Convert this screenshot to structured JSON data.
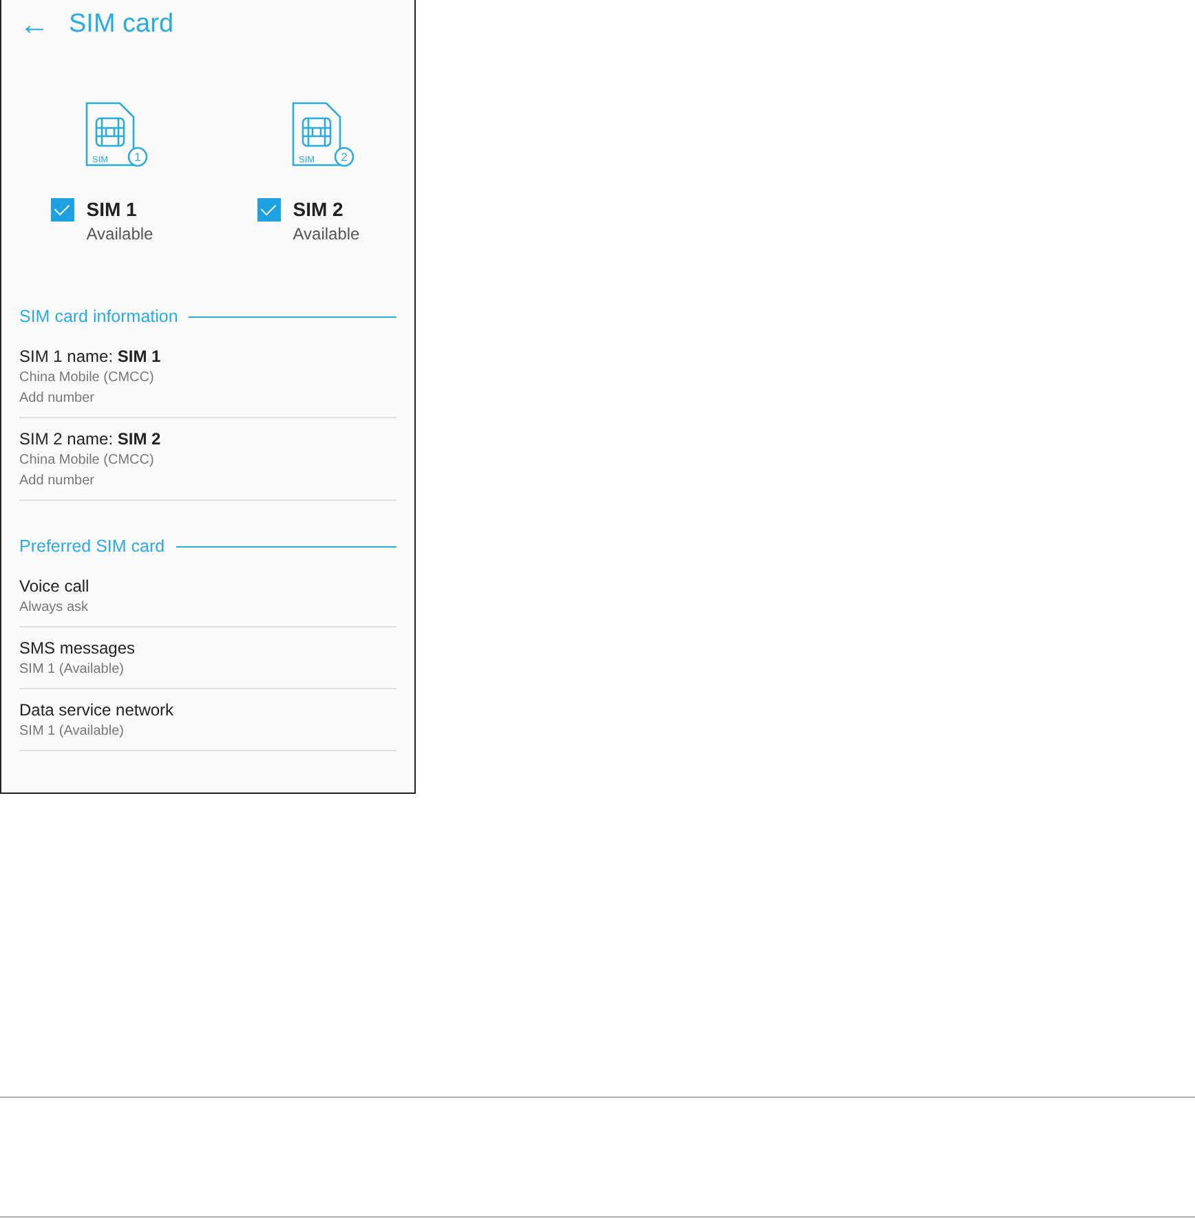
{
  "app_bar": {
    "back": "←",
    "title": "SIM card"
  },
  "sims": [
    {
      "badge": "SIM",
      "number": "1",
      "name": "SIM 1",
      "status": "Available",
      "checked": true
    },
    {
      "badge": "SIM",
      "number": "2",
      "name": "SIM 2",
      "status": "Available",
      "checked": true
    }
  ],
  "sections": [
    {
      "title": "SIM card information",
      "items": [
        {
          "title": "SIM 1 name: **SIM 1**",
          "lines": [
            "China Mobile (CMCC)",
            "Add number"
          ]
        },
        {
          "title": "SIM 2 name: **SIM 2**",
          "lines": [
            "China Mobile (CMCC)",
            "Add number"
          ]
        }
      ]
    },
    {
      "title": "Preferred SIM card",
      "items": [
        {
          "title": "Voice call",
          "lines": [
            "Always ask"
          ]
        },
        {
          "title": "SMS messages",
          "lines": [
            "SIM 1 (Available)"
          ]
        },
        {
          "title": "Data service network",
          "lines": [
            "SIM 1 (Available)"
          ]
        }
      ]
    }
  ]
}
